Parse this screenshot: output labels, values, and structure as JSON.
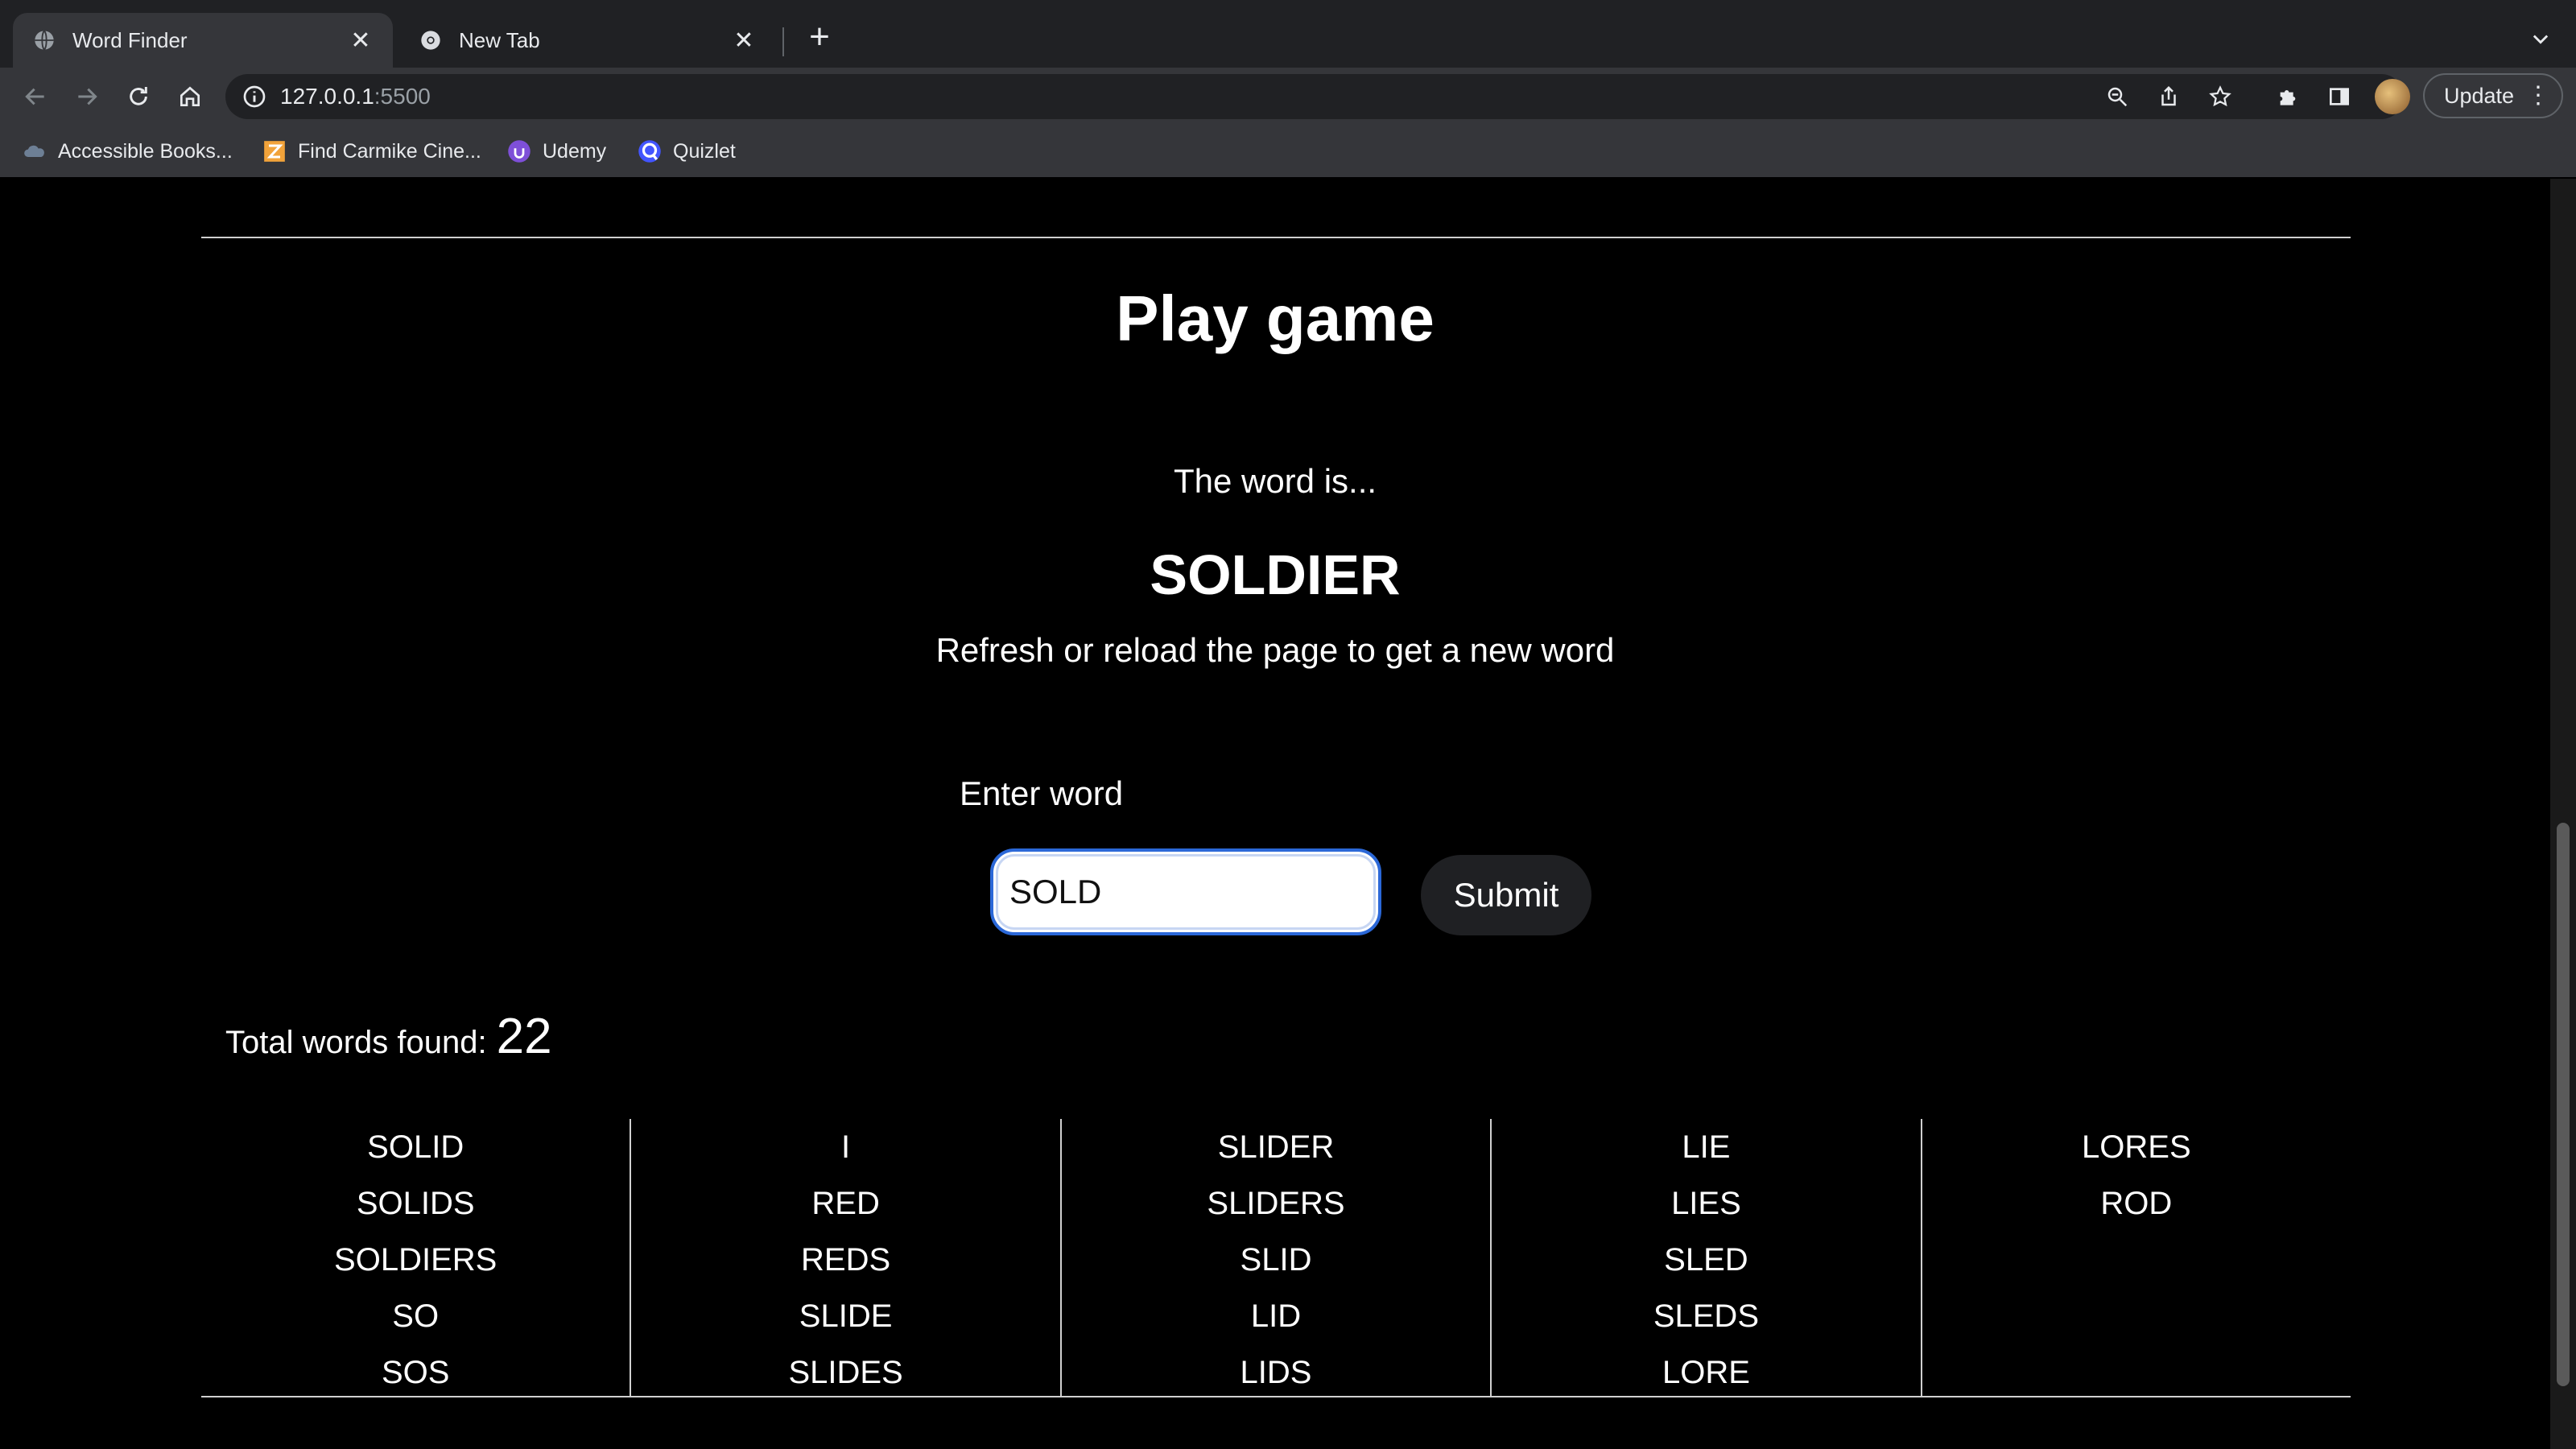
{
  "browser": {
    "tabs": [
      {
        "title": "Word Finder",
        "active": true
      },
      {
        "title": "New Tab",
        "active": false
      }
    ],
    "url_host": "127.0.0.1",
    "url_port": ":5500",
    "update_label": "Update",
    "bookmarks": [
      {
        "label": "Accessible Books...",
        "icon": "cloud-icon"
      },
      {
        "label": "Find Carmike Cine...",
        "icon": "carmike-icon"
      },
      {
        "label": "Udemy",
        "icon": "udemy-icon"
      },
      {
        "label": "Quizlet",
        "icon": "quizlet-icon"
      }
    ]
  },
  "game": {
    "title": "Play game",
    "intro": "The word is...",
    "word": "SOLDIER",
    "refresh_hint": "Refresh or reload the page to get a new word",
    "input_label": "Enter word",
    "input_value": "SOLD",
    "submit_label": "Submit",
    "total_label": "Total words found:",
    "total_count": "22",
    "found_words": [
      [
        "SOLID",
        "SOLIDS",
        "SOLDIERS",
        "SO",
        "SOS"
      ],
      [
        "I",
        "RED",
        "REDS",
        "SLIDE",
        "SLIDES"
      ],
      [
        "SLIDER",
        "SLIDERS",
        "SLID",
        "LID",
        "LIDS"
      ],
      [
        "LIE",
        "LIES",
        "SLED",
        "SLEDS",
        "LORE"
      ],
      [
        "LORES",
        "ROD"
      ]
    ]
  },
  "colors": {
    "page_bg": "#000000",
    "chrome_bg": "#202124",
    "toolbar_bg": "#35363a",
    "input_focus": "#2b68d8",
    "submit_bg": "#1f2023"
  }
}
